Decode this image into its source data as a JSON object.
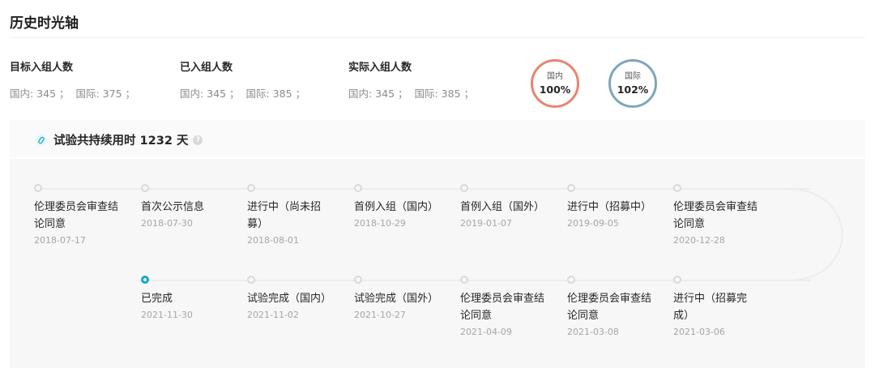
{
  "page": {
    "title": "历史时光轴"
  },
  "stats": [
    {
      "label": "目标入组人数",
      "domestic_label": "国内: 345 ；",
      "intl_label": "国际: 375 ；"
    },
    {
      "label": "已入组人数",
      "domestic_label": "国内: 345 ；",
      "intl_label": "国际: 385 ；"
    },
    {
      "label": "实际入组人数",
      "domestic_label": "国内: 345 ；",
      "intl_label": "国际: 385 ；"
    }
  ],
  "rings": [
    {
      "label": "国内",
      "value": "100%",
      "color": "#e8846f"
    },
    {
      "label": "国际",
      "value": "102%",
      "color": "#7ea6b9"
    }
  ],
  "duration": {
    "text": "试验共持续用时 1232 天",
    "help": "?"
  },
  "timeline": {
    "row1": [
      {
        "title": "伦理委员会审查结论同意",
        "date": "2018-07-17"
      },
      {
        "title": "首次公示信息",
        "date": "2018-07-30"
      },
      {
        "title": "进行中（尚未招募）",
        "date": "2018-08-01"
      },
      {
        "title": "首例入组（国内）",
        "date": "2018-10-29"
      },
      {
        "title": "首例入组（国外）",
        "date": "2019-01-07"
      },
      {
        "title": "进行中（招募中）",
        "date": "2019-09-05"
      },
      {
        "title": "伦理委员会审查结论同意",
        "date": "2020-12-28"
      }
    ],
    "row2": [
      {
        "title": "已完成",
        "date": "2021-11-30",
        "active": true
      },
      {
        "title": "试验完成（国内）",
        "date": "2021-11-02"
      },
      {
        "title": "试验完成（国外）",
        "date": "2021-10-27"
      },
      {
        "title": "伦理委员会审查结论同意",
        "date": "2021-04-09"
      },
      {
        "title": "伦理委员会审查结论同意",
        "date": "2021-03-08"
      },
      {
        "title": "进行中（招募完成）",
        "date": "2021-03-06"
      }
    ]
  }
}
